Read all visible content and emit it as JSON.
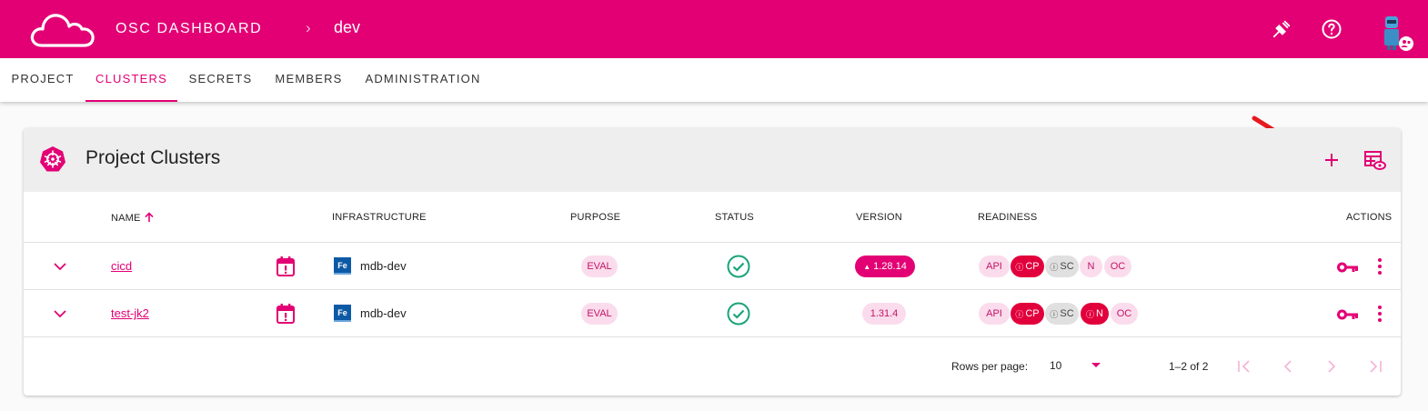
{
  "header": {
    "app_title": "OSC DASHBOARD",
    "breadcrumb_sep": "›",
    "breadcrumb_project": "dev",
    "icons": [
      "plug-icon",
      "help-icon",
      "avatar"
    ],
    "brand_color": "#e20074"
  },
  "tabs": [
    {
      "label": "PROJECT",
      "active": false
    },
    {
      "label": "CLUSTERS",
      "active": true
    },
    {
      "label": "SECRETS",
      "active": false
    },
    {
      "label": "MEMBERS",
      "active": false
    },
    {
      "label": "ADMINISTRATION",
      "active": false
    }
  ],
  "card": {
    "title": "Project Clusters",
    "icon": "kubernetes-icon",
    "actions": [
      "add-icon",
      "table-view-icon"
    ]
  },
  "table": {
    "columns": {
      "name": "NAME",
      "infrastructure": "INFRASTRUCTURE",
      "purpose": "PURPOSE",
      "status": "STATUS",
      "version": "VERSION",
      "readiness": "READINESS",
      "actions": "ACTIONS"
    },
    "rows": [
      {
        "name": "cicd",
        "infra_badge": "Fe",
        "infrastructure": "mdb-dev",
        "purpose": "EVAL",
        "status": "healthy",
        "version": "1.28.14",
        "version_upgrade_available": true,
        "readiness": [
          {
            "label": "API",
            "style": "light",
            "icon": false
          },
          {
            "label": "CP",
            "style": "red",
            "icon": true
          },
          {
            "label": "SC",
            "style": "gray",
            "icon": true
          },
          {
            "label": "N",
            "style": "light",
            "icon": false
          },
          {
            "label": "OC",
            "style": "light",
            "icon": false
          }
        ]
      },
      {
        "name": "test-jk2",
        "infra_badge": "Fe",
        "infrastructure": "mdb-dev",
        "purpose": "EVAL",
        "status": "healthy",
        "version": "1.31.4",
        "version_upgrade_available": false,
        "readiness": [
          {
            "label": "API",
            "style": "light",
            "icon": false
          },
          {
            "label": "CP",
            "style": "red",
            "icon": true
          },
          {
            "label": "SC",
            "style": "gray",
            "icon": true
          },
          {
            "label": "N",
            "style": "red",
            "icon": true
          },
          {
            "label": "OC",
            "style": "light",
            "icon": false
          }
        ]
      }
    ],
    "footer": {
      "rows_per_page_label": "Rows per page:",
      "rows_per_page_value": "10",
      "range_text": "1–2 of 2"
    }
  }
}
